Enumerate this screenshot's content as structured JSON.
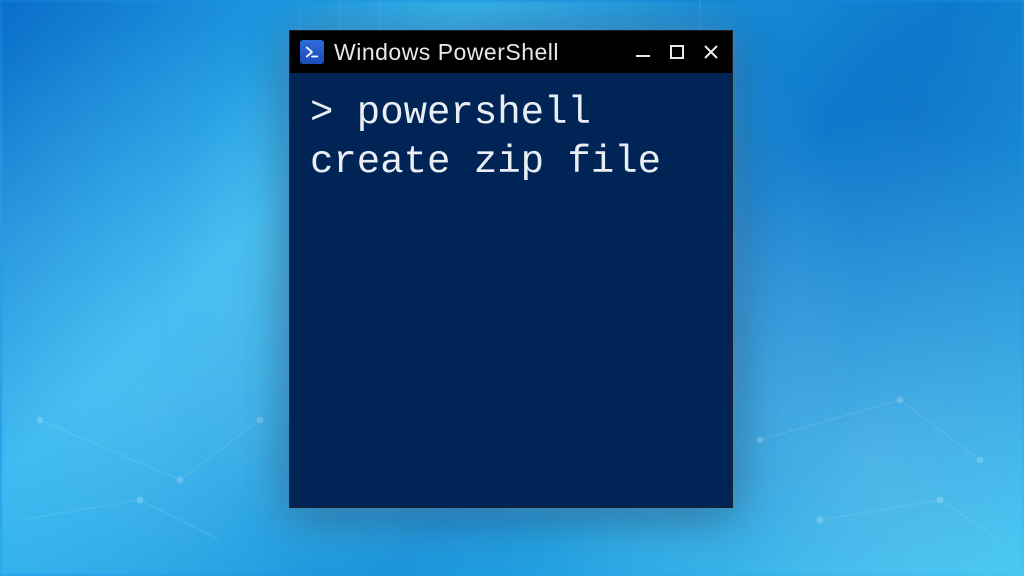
{
  "window": {
    "title": "Windows PowerShell",
    "icon_glyph": ">_"
  },
  "controls": {
    "minimize_label": "Minimize",
    "maximize_label": "Maximize",
    "close_label": "Close"
  },
  "terminal": {
    "prompt": ">",
    "command": "powershell create zip file",
    "full_line": "> powershell create zip file"
  },
  "colors": {
    "terminal_bg": "#012456",
    "titlebar_bg": "#000000",
    "text": "#e8eef4",
    "accent_blue": "#2e6cd6"
  }
}
